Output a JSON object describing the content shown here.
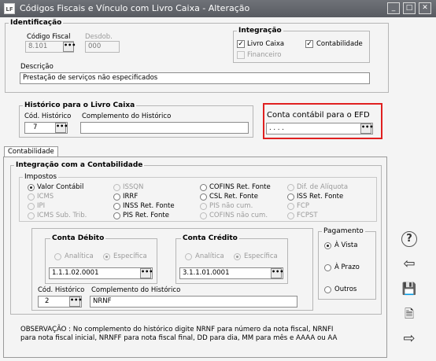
{
  "window": {
    "title": "Códigos Fiscais e Vínculo com Livro Caixa - Alteração",
    "app_icon_text": "LF",
    "btn_minimize": "_",
    "btn_maximize": "□",
    "btn_close": "✕"
  },
  "identificacao": {
    "legend": "Identificação",
    "codigo_fiscal_label": "Código Fiscal",
    "codigo_fiscal_value": "8.101",
    "desdob_label": "Desdob.",
    "desdob_value": "000",
    "descricao_label": "Descrição",
    "descricao_value": "Prestação de serviços não especificados"
  },
  "integracao": {
    "legend": "Integração",
    "livro_caixa": "Livro Caixa",
    "contabilidade": "Contabilidade",
    "financeiro": "Financeiro"
  },
  "historico": {
    "legend": "Histórico para o Livro Caixa",
    "cod_label": "Cód. Histórico",
    "cod_value": "7",
    "comp_label": "Complemento do Histórico",
    "comp_value": ""
  },
  "efd": {
    "label": "Conta contábil para o EFD",
    "value": ". . . ."
  },
  "tabs": {
    "contabilidade": "Contabilidade"
  },
  "integ_contab": {
    "legend": "Integração com a Contabilidade",
    "impostos_label": "Impostos",
    "impostos": {
      "valor_contabil": "Valor Contábil",
      "icms": "ICMS",
      "ipi": "IPI",
      "icms_sub": "ICMS Sub. Trib.",
      "issqn": "ISSQN",
      "irrf": "IRRF",
      "inss": "INSS Ret. Fonte",
      "pis": "PIS Ret. Fonte",
      "cofins_ret": "COFINS Ret. Fonte",
      "csl_ret": "CSL Ret. Fonte",
      "pis_nao": "PIS não cum.",
      "cofins_nao": "COFINS não cum.",
      "dif_aliquota": "Dif. de Alíquota",
      "iss_ret": "ISS Ret. Fonte",
      "fcp": "FCP",
      "fcpst": "FCPST"
    },
    "conta_debito": {
      "legend": "Conta Débito",
      "analitica": "Analítica",
      "especifica": "Específica",
      "value": "1.1.1.02.0001"
    },
    "conta_credito": {
      "legend": "Conta Crédito",
      "analitica": "Analítica",
      "especifica": "Específica",
      "value": "3.1.1.01.0001"
    },
    "cod_hist_label": "Cód. Histórico",
    "cod_hist_value": "2",
    "comp_hist_label": "Complemento do Histórico",
    "comp_hist_value": "NRNF",
    "pagamento": {
      "legend": "Pagamento",
      "a_vista": "À Vista",
      "a_prazo": "À Prazo",
      "outros": "Outros"
    }
  },
  "observacao": "OBSERVAÇÃO : No complemento do histórico digite NRNF para número da nota fiscal, NRNFI\npara nota fiscal inicial, NRNFF para nota fiscal final, DD para dia, MM para mês e AAAA ou AA",
  "lookup_glyph": "•••",
  "sidebar": {
    "help": "?",
    "back": "⇦",
    "save": "💾",
    "print": "🗎",
    "next": "⇨"
  },
  "colors": {
    "highlight": "#e02020",
    "titlebar": "#5f6268"
  }
}
